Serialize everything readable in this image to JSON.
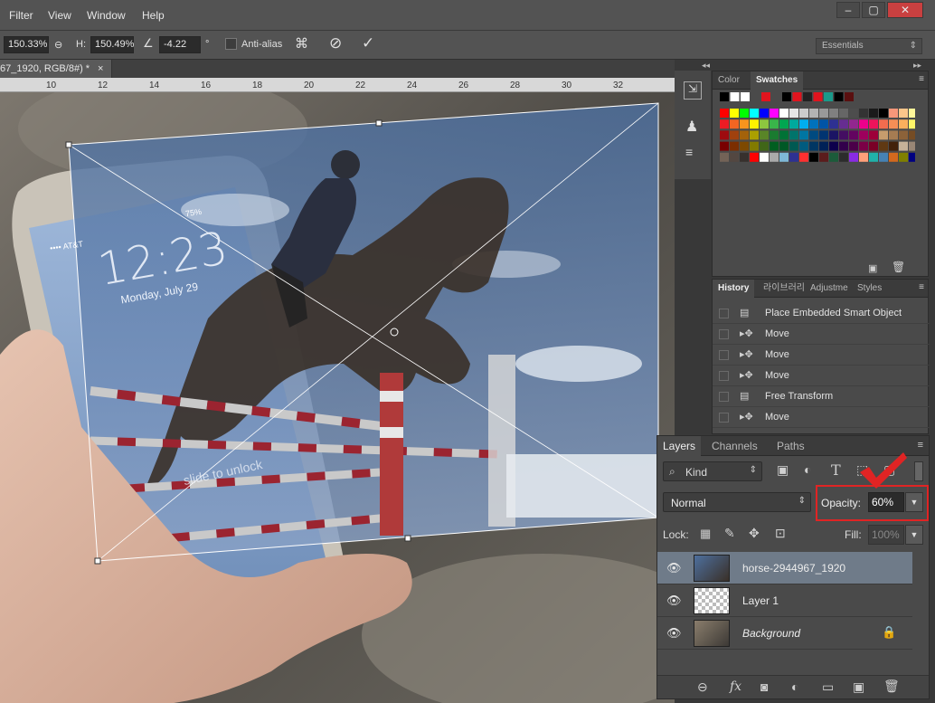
{
  "menu": [
    "Filter",
    "View",
    "Window",
    "Help"
  ],
  "window_buttons": [
    "–",
    "▢",
    "✕"
  ],
  "options": {
    "width_value": "150.33%",
    "height_label": "H:",
    "height_value": "150.49%",
    "angle_value": "-4.22",
    "angle_unit": "°",
    "antialias_label": "Anti-alias",
    "workspace": "Essentials"
  },
  "document": {
    "tab_label": "67_1920, RGB/8#) *",
    "close": "×"
  },
  "ruler": [
    "10",
    "12",
    "14",
    "16",
    "18",
    "20",
    "22",
    "24",
    "26",
    "28",
    "30",
    "32"
  ],
  "phone": {
    "carrier": "•••• AT&T",
    "time": "12:23",
    "date": "Monday, July 29",
    "battery": "75%",
    "slide": "slide to unlock"
  },
  "panels": {
    "color_tab": "Color",
    "swatches_tab": "Swatches",
    "history_tab": "History",
    "library_tab": "라이브러리",
    "adjust_tab": "Adjustme",
    "styles_tab": "Styles",
    "history_items": [
      {
        "label": "Place Embedded Smart Object",
        "icon": "doc-icon"
      },
      {
        "label": "Move",
        "icon": "move-icon"
      },
      {
        "label": "Move",
        "icon": "move-icon"
      },
      {
        "label": "Move",
        "icon": "move-icon"
      },
      {
        "label": "Free Transform",
        "icon": "doc-icon"
      },
      {
        "label": "Move",
        "icon": "move-icon"
      }
    ]
  },
  "layers": {
    "tabs": [
      "Layers",
      "Channels",
      "Paths"
    ],
    "kind": "Kind",
    "blend_mode": "Normal",
    "opacity_label": "Opacity:",
    "opacity_value": "60%",
    "lock_label": "Lock:",
    "fill_label": "Fill:",
    "fill_value": "100%",
    "items": [
      {
        "name": "horse-2944967_1920",
        "selected": true,
        "italic": false
      },
      {
        "name": "Layer 1",
        "selected": false,
        "italic": false
      },
      {
        "name": "Background",
        "selected": false,
        "italic": true
      }
    ]
  },
  "colors": {
    "highlight_box": "#e02424",
    "checkmark": "#e02424",
    "selected_layer": "#6f7b89"
  }
}
